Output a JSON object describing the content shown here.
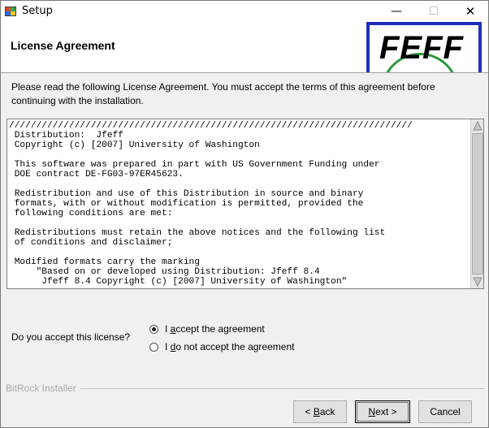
{
  "window": {
    "title": "Setup",
    "minimize_glyph": "—",
    "maximize_glyph": "☐",
    "close_glyph": "✕"
  },
  "header": {
    "page_title": "License Agreement",
    "logo_text": "FEFF"
  },
  "intro": "Please read the following License Agreement. You must accept the terms of this agreement before continuing with the installation.",
  "license_text": "//////////////////////////////////////////////////////////////////////////\n Distribution:  Jfeff\n Copyright (c) [2007] University of Washington\n\n This software was prepared in part with US Government Funding under\n DOE contract DE-FG03-97ER45623.\n\n Redistribution and use of this Distribution in source and binary\n formats, with or without modification is permitted, provided the\n following conditions are met:\n\n Redistributions must retain the above notices and the following list\n of conditions and disclaimer;\n\n Modified formats carry the marking\n     \"Based on or developed using Distribution: Jfeff 8.4\n      Jfeff 8.4 Copyright (c) [2007] University of Washington\"",
  "question": "Do you accept this license?",
  "options": {
    "accept": {
      "pre": "I ",
      "key": "a",
      "post": "ccept the agreement",
      "selected": true
    },
    "decline": {
      "pre": "I ",
      "key": "d",
      "post": "o not accept the agreement",
      "selected": false
    }
  },
  "brand": "BitRock Installer",
  "buttons": {
    "back": {
      "pre": "< ",
      "key": "B",
      "post": "ack"
    },
    "next": {
      "key": "N",
      "post": "ext >"
    },
    "cancel": {
      "label": "Cancel"
    }
  },
  "colors": {
    "logo_border": "#1f2fb8",
    "logo_circle": "#2a9a3a",
    "header_bg": "#ffffff",
    "body_bg": "#f0f0f0"
  },
  "icons": {
    "app": "setup-app-icon",
    "scroll_up": "triangle-up-icon",
    "scroll_down": "triangle-down-icon"
  }
}
